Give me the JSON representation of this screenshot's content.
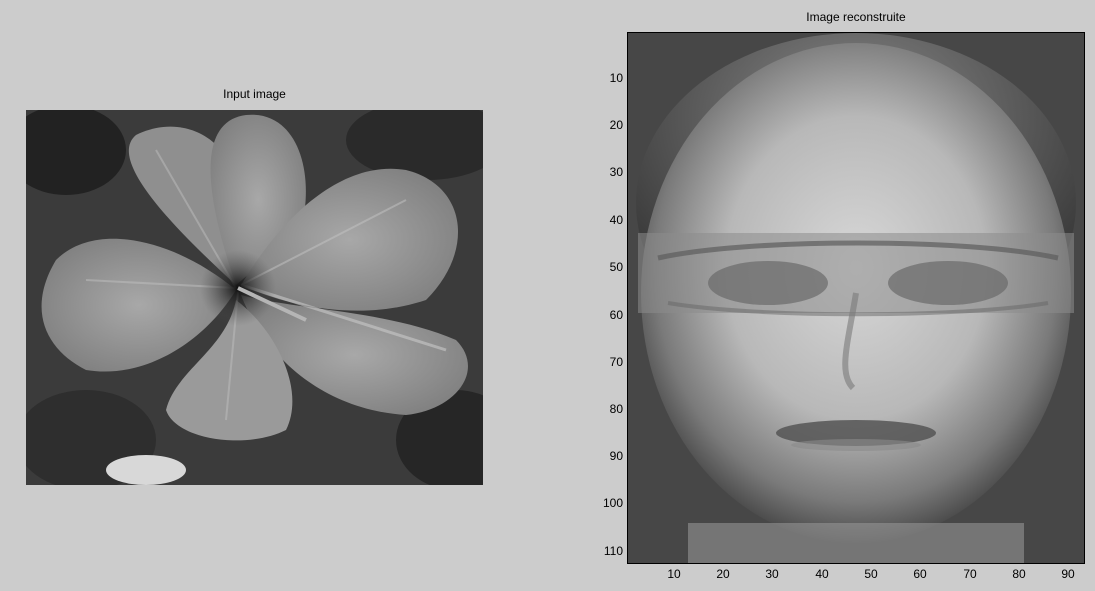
{
  "figure": {
    "background": "#cccccc"
  },
  "left_axes": {
    "title": "Input image",
    "content": "flower-image"
  },
  "right_axes": {
    "title": "Image reconstruite",
    "content": "face-image",
    "x_ticks": [
      "10",
      "20",
      "30",
      "40",
      "50",
      "60",
      "70",
      "80",
      "90"
    ],
    "y_ticks": [
      "10",
      "20",
      "30",
      "40",
      "50",
      "60",
      "70",
      "80",
      "90",
      "100",
      "110"
    ],
    "xlim": [
      0.5,
      92.5
    ],
    "ylim": [
      0.5,
      112.5
    ]
  }
}
